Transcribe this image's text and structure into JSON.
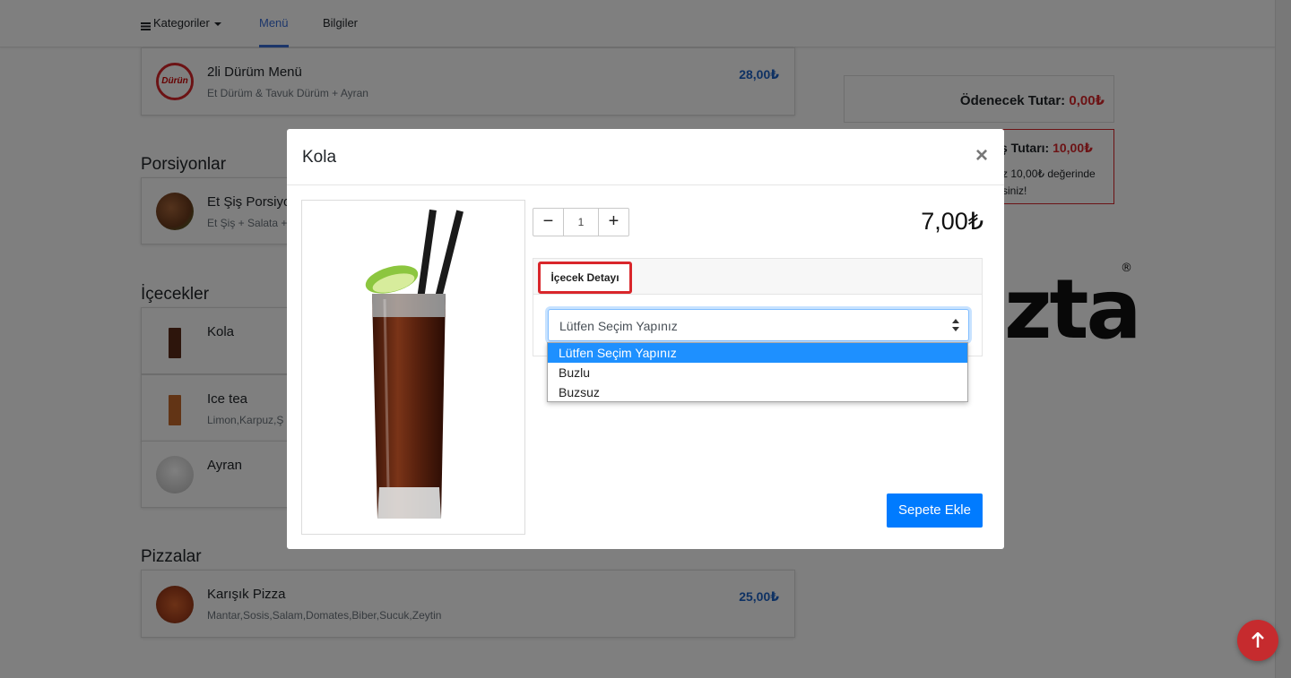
{
  "nav": {
    "categories_label": "Kategoriler",
    "menu_label": "Menü",
    "info_label": "Bilgiler"
  },
  "sections": [
    {
      "title": "",
      "items": [
        {
          "name": "2li Dürüm Menü",
          "description": "Et Dürüm & Tavuk Dürüm + Ayran",
          "price": "28,00₺",
          "thumb_text": "Dürün"
        }
      ]
    },
    {
      "title": "Porsiyonlar",
      "items": [
        {
          "name": "Et Şiş Porsiyo",
          "description": "Et Şiş + Salata +"
        }
      ]
    },
    {
      "title": "İçecekler",
      "items": [
        {
          "name": "Kola",
          "description": ""
        },
        {
          "name": "Ice tea",
          "description": "Limon,Karpuz,Ş"
        },
        {
          "name": "Ayran",
          "description": ""
        }
      ]
    },
    {
      "title": "Pizzalar",
      "items": [
        {
          "name": "Karışık Pizza",
          "description": "Mantar,Sosis,Salam,Domates,Biber,Sucuk,Zeytin",
          "price": "25,00₺"
        }
      ]
    }
  ],
  "cart": {
    "payable_label": "Ödenecek Tutar:",
    "payable_value": "0,00₺",
    "min_label": "ş Tutarı:",
    "min_value": "10,00₺",
    "min_text_line1": "z 10,00₺ değerinde",
    "min_text_line2": "siniz!"
  },
  "brand": {
    "logo_text": "zta",
    "registered": "®"
  },
  "modal": {
    "title": "Kola",
    "close_symbol": "×",
    "quantity": "1",
    "minus_symbol": "−",
    "plus_symbol": "+",
    "price": "7,00₺",
    "detail_tab": "İçecek Detayı",
    "select_value": "Lütfen Seçim Yapınız",
    "options": [
      "Lütfen Seçim Yapınız",
      "Buzlu",
      "Buzsuz"
    ],
    "selected_option_index": 0,
    "add_button": "Sepete Ekle"
  },
  "colors": {
    "accent_blue": "#007bff",
    "price_blue": "#1d62c7",
    "brand_red": "#d9262b",
    "scroll_top_red": "#c62b2e"
  },
  "icons": {
    "hamburger": "hamburger-icon",
    "close": "close-icon",
    "select_arrows": "sort-arrows-icon",
    "scroll_top": "arrow-up-icon"
  }
}
